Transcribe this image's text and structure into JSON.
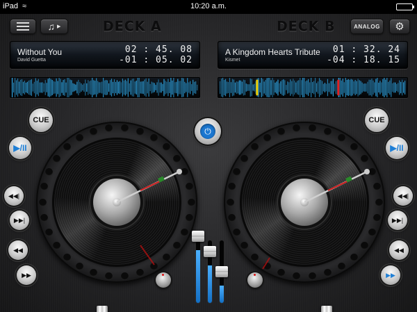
{
  "statusbar": {
    "carrier": "iPad",
    "wifi_icon": "wifi-icon",
    "time": "10:20 a.m.",
    "battery_icon": "battery-icon",
    "battery_level": 1.0
  },
  "toolbar": {
    "menu_icon": "hamburger-menu-icon",
    "music_icon": "music-note-icon",
    "analog_label": "ANALOG",
    "settings_icon": "gear-icon"
  },
  "deck_a": {
    "title": "DECK A",
    "track": "Without You",
    "artist": "David Guetta",
    "elapsed": "02 : 45. 08",
    "remaining": "-01 : 05. 02",
    "cue_label": "CUE",
    "play_label": "▶/II",
    "waveform_markers": [],
    "slider_position": 0.42,
    "leds_on": 5,
    "led_count": 15
  },
  "deck_b": {
    "title": "DECK B",
    "track": "A Kingdom Hearts Tribute",
    "artist": "Kismet",
    "elapsed": "01 : 32. 24",
    "remaining": "-04 : 18. 15",
    "cue_label": "CUE",
    "play_label": "▶/II",
    "waveform_markers": [
      {
        "position": 0.2,
        "color": "#f0d000"
      },
      {
        "position": 0.63,
        "color": "#e02020"
      }
    ],
    "slider_position": 0.66,
    "leds_on": 9,
    "led_count": 15
  },
  "mixer": {
    "power_icon": "power-icon",
    "faders": [
      {
        "name": "gain-a",
        "level": 0.85
      },
      {
        "name": "gain-b",
        "level": 0.6
      },
      {
        "name": "crossfader-vol",
        "level": 0.28
      }
    ]
  },
  "colors": {
    "accent": "#1f7fd6",
    "waveform": "#2fa8e8",
    "panel": "#2a2a2c"
  }
}
